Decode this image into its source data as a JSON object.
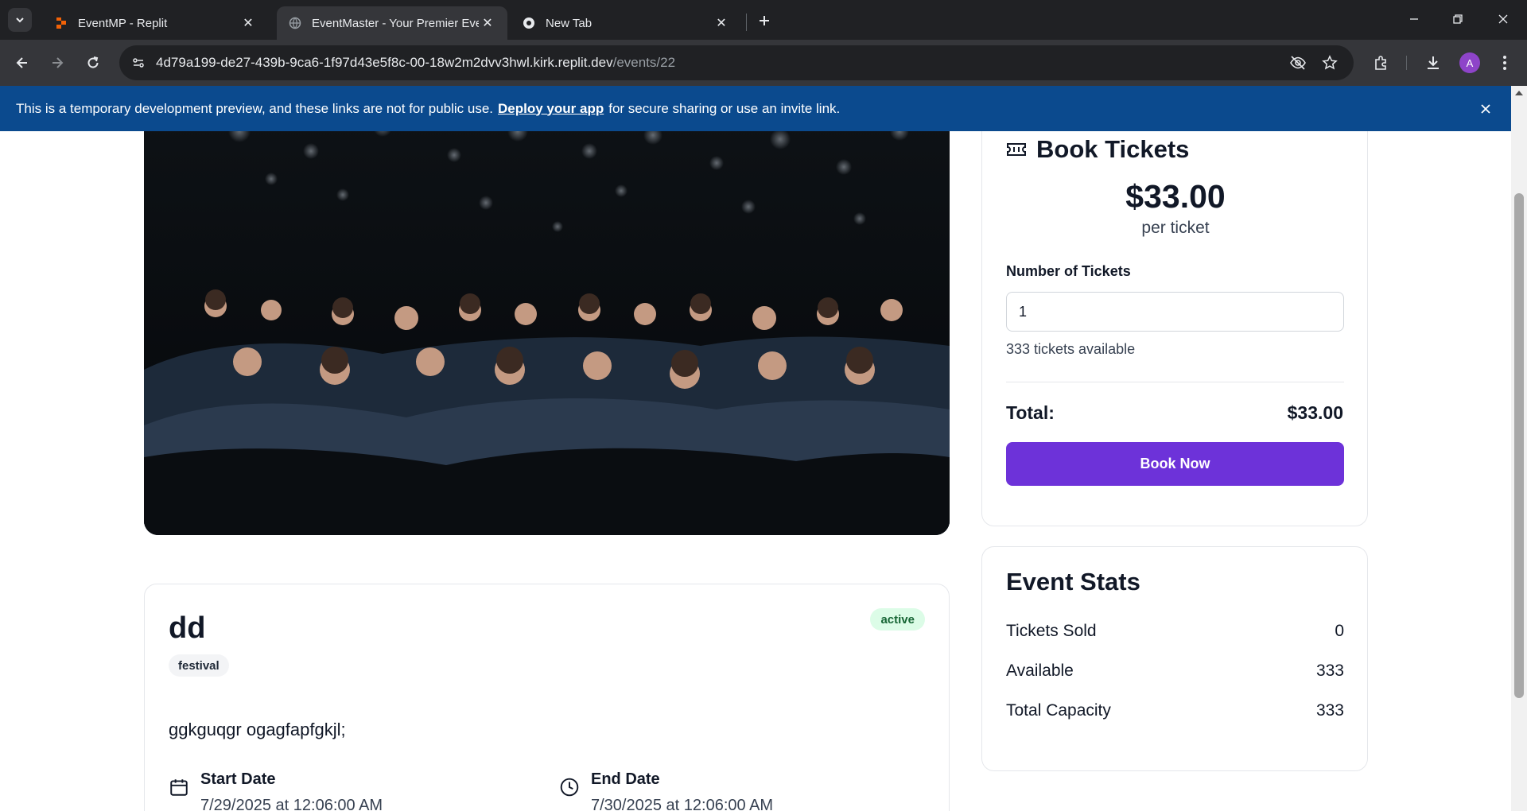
{
  "browser": {
    "tabs": [
      {
        "title": "EventMP - Replit",
        "active": false
      },
      {
        "title": "EventMaster - Your Premier Eve",
        "active": true
      },
      {
        "title": "New Tab",
        "active": false
      }
    ],
    "url_host": "4d79a199-de27-439b-9ca6-1f97d43e5f8c-00-18w2m2dvv3hwl.kirk.replit.dev",
    "url_path": "/events/22",
    "profile_initial": "A"
  },
  "banner": {
    "text_before": "This is a temporary development preview, and these links are not for public use.",
    "link": "Deploy your app",
    "text_after": "for secure sharing or use an invite link."
  },
  "event": {
    "title": "dd",
    "status": "active",
    "category": "festival",
    "description": "ggkguqgr ogagfapfgkjl;",
    "start_label": "Start Date",
    "start_value": "7/29/2025 at 12:06:00 AM",
    "end_label": "End Date",
    "end_value": "7/30/2025 at 12:06:00 AM"
  },
  "booking": {
    "title": "Book Tickets",
    "price": "$33.00",
    "per_ticket": "per ticket",
    "num_label": "Number of Tickets",
    "num_value": "1",
    "available_text": "333 tickets available",
    "total_label": "Total:",
    "total_value": "$33.00",
    "button": "Book Now"
  },
  "stats": {
    "title": "Event Stats",
    "rows": [
      {
        "label": "Tickets Sold",
        "value": "0"
      },
      {
        "label": "Available",
        "value": "333"
      },
      {
        "label": "Total Capacity",
        "value": "333"
      }
    ]
  },
  "colors": {
    "accent": "#6d32d9",
    "banner": "#0b4a8e",
    "status_bg": "#dcfce7",
    "status_fg": "#166534"
  }
}
